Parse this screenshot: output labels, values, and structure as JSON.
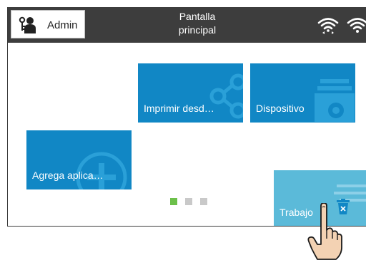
{
  "header": {
    "admin_label": "Admin",
    "title_line1": "Pantalla",
    "title_line2": "principal"
  },
  "tiles": {
    "print_from": "Imprimir desd…",
    "device": "Dispositivo",
    "add_apps": "Agrega aplica…",
    "jobs": "Trabajo"
  },
  "pager": {
    "pages": 3,
    "current": 1
  },
  "colors": {
    "topbar": "#3d3d3d",
    "tile": "#1187c5",
    "tile_pressed": "#5bbad9",
    "pager_active": "#6cc04a",
    "pager_inactive": "#c9c9c9"
  },
  "icons": [
    "admin-user-key-icon",
    "wifi-icon",
    "wifi-direct-icon",
    "printer-gear-icon",
    "add-plus-icon",
    "share-icon",
    "delete-trash-icon",
    "finger-tap-pointer"
  ]
}
